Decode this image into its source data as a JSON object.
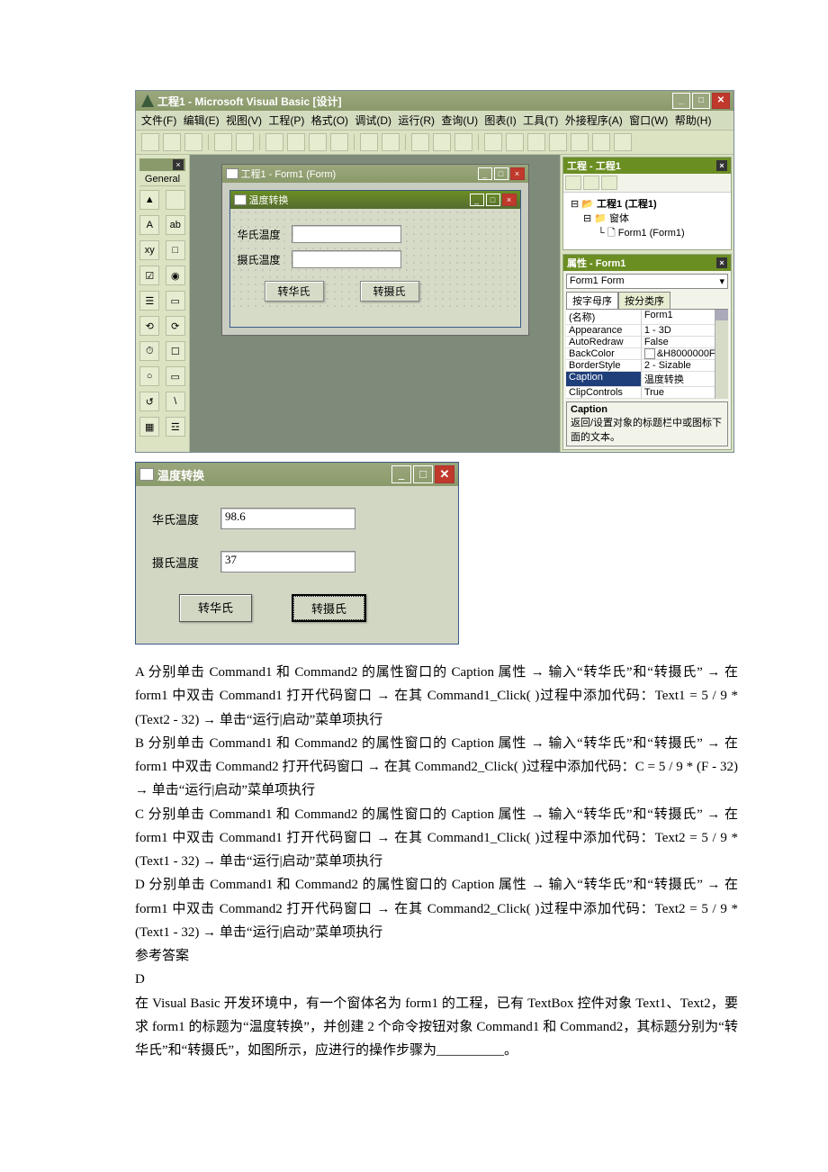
{
  "ide": {
    "title": "工程1 - Microsoft Visual Basic [设计]",
    "menus": [
      "文件(F)",
      "编辑(E)",
      "视图(V)",
      "工程(P)",
      "格式(O)",
      "调试(D)",
      "运行(R)",
      "查询(U)",
      "图表(I)",
      "工具(T)",
      "外接程序(A)",
      "窗口(W)",
      "帮助(H)"
    ],
    "toolbox_general": "General",
    "toolbox_items": [
      "▲",
      "",
      "A",
      "ab",
      "xy",
      "□",
      "☑",
      "◉",
      "☰",
      "▭",
      "⟲",
      "⟳",
      "⏱",
      "☐",
      "○",
      "▭",
      "↺",
      "\\",
      "▦",
      "☲"
    ],
    "form_host_title": "工程1 - Form1 (Form)",
    "design_form_title": "温度转换",
    "label1": "华氏温度",
    "label2": "摄氏温度",
    "btn1": "转华氏",
    "btn2": "转摄氏",
    "project_pane_title": "工程 - 工程1",
    "project_tree": {
      "root": "工程1 (工程1)",
      "folder": "窗体",
      "form": "Form1 (Form1)"
    },
    "prop_pane_title": "属性 - Form1",
    "prop_combo": "Form1 Form",
    "prop_tabs": [
      "按字母序",
      "按分类序"
    ],
    "props": [
      {
        "k": "(名称)",
        "v": "Form1"
      },
      {
        "k": "Appearance",
        "v": "1 - 3D"
      },
      {
        "k": "AutoRedraw",
        "v": "False"
      },
      {
        "k": "BackColor",
        "v": "&H8000000F&"
      },
      {
        "k": "BorderStyle",
        "v": "2 - Sizable"
      },
      {
        "k": "Caption",
        "v": "温度转换",
        "sel": true
      },
      {
        "k": "ClipControls",
        "v": "True"
      }
    ],
    "prop_desc_title": "Caption",
    "prop_desc_body": "返回/设置对象的标题栏中或图标下面的文本。"
  },
  "runtime": {
    "title": "温度转换",
    "label1": "华氏温度",
    "val1": "98.6",
    "label2": "摄氏温度",
    "val2": "37",
    "btn1": "转华氏",
    "btn2": "转摄氏"
  },
  "question": {
    "optA": "A 分别单击 Command1 和 Command2 的属性窗口的 Caption 属性 → 输入“转华氏”和“转摄氏”  → 在 form1 中双击 Command1 打开代码窗口 → 在其 Command1_Click( )过程中添加代码：Text1 = 5 / 9 * (Text2 - 32) → 单击“运行|启动”菜单项执行",
    "optB": "B 分别单击 Command1 和 Command2 的属性窗口的 Caption 属性 → 输入“转华氏”和“转摄氏”  → 在 form1 中双击 Command2 打开代码窗口 → 在其 Command2_Click( )过程中添加代码：C = 5 / 9 * (F - 32) → 单击“运行|启动”菜单项执行",
    "optC": "C 分别单击 Command1 和 Command2 的属性窗口的 Caption 属性 → 输入“转华氏”和“转摄氏”  → 在 form1 中双击 Command1 打开代码窗口 → 在其 Command1_Click( )过程中添加代码：Text2 = 5 / 9 * (Text1 - 32) → 单击“运行|启动”菜单项执行",
    "optD": "D 分别单击 Command1 和 Command2 的属性窗口的 Caption 属性 → 输入“转华氏”和“转摄氏”  → 在 form1 中双击 Command2 打开代码窗口 → 在其 Command2_Click( )过程中添加代码：Text2 = 5 / 9 * (Text1 - 32) → 单击“运行|启动”菜单项执行",
    "ref_label": "参考答案",
    "ref_answer": "D",
    "stem": "在 Visual Basic 开发环境中，有一个窗体名为 form1 的工程，已有 TextBox 控件对象 Text1、Text2，要求 form1 的标题为“温度转换”，并创建 2 个命令按钮对象 Command1 和 Command2，其标题分别为“转华氏”和“转摄氏”，如图所示，应进行的操作步骤为__________。"
  }
}
